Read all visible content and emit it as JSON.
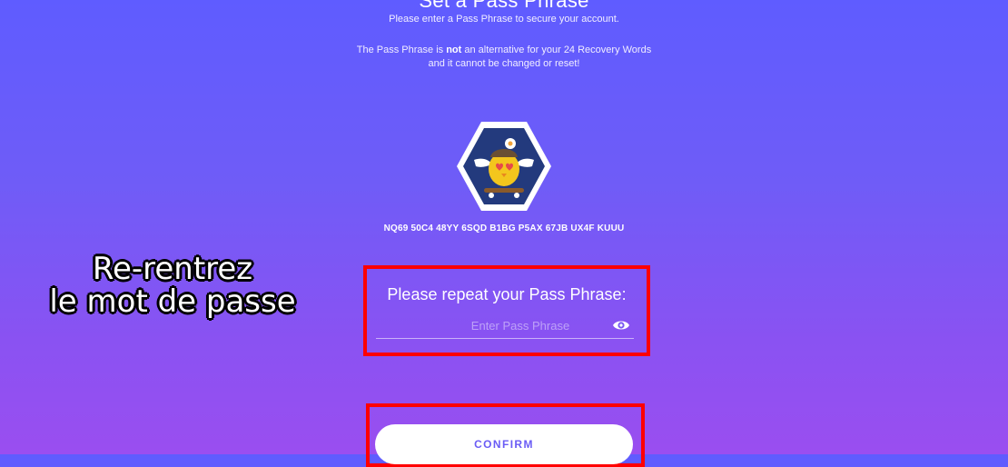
{
  "header": {
    "title": "Set a Pass Phrase",
    "subtitle": "Please enter a Pass Phrase to secure your account.",
    "warning_pre": "The Pass Phrase is ",
    "warning_bold": "not",
    "warning_post": " an alternative for your 24 Recovery Words and it cannot be changed or reset!"
  },
  "account": {
    "avatar_icon": "flying-chick-skateboard-avatar-icon",
    "id": "NQ69 50C4 48YY 6SQD B1BG P5AX 67JB UX4F KUUU"
  },
  "annotation": {
    "line1": "Re-rentrez",
    "line2": "le mot de passe",
    "highlight_color": "#ff0000"
  },
  "form": {
    "label": "Please repeat your Pass Phrase:",
    "value": "",
    "placeholder": "Enter Pass Phrase",
    "toggle_icon": "eye-icon"
  },
  "actions": {
    "confirm_label": "CONFIRM"
  },
  "colors": {
    "background_top": "#5f5cff",
    "background_bottom": "#9a4ef0",
    "button_text": "#6a5cf5"
  }
}
